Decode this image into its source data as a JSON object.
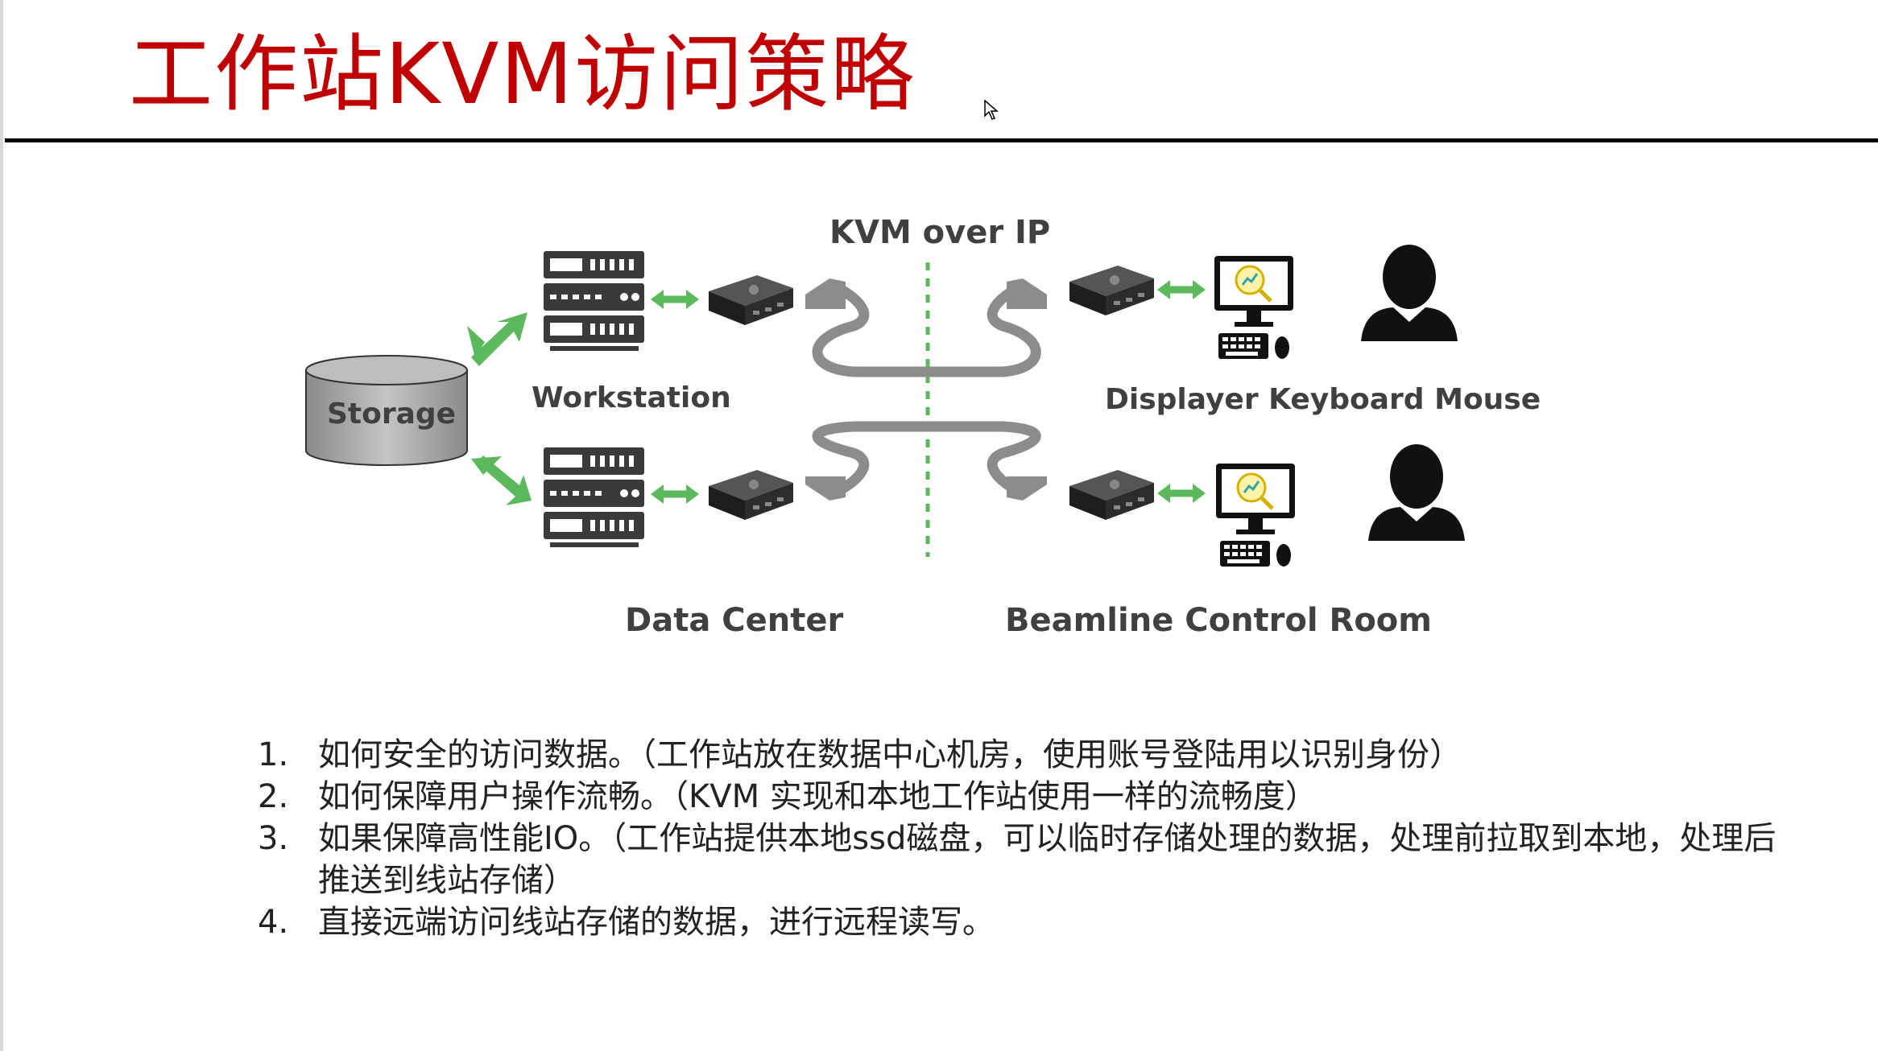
{
  "slide": {
    "title": "工作站KVM访问策略"
  },
  "diagram": {
    "kvm_label": "KVM over IP",
    "storage_label": "Storage",
    "workstation_label": "Workstation",
    "displayer_label": "Displayer Keyboard Mouse",
    "datacenter_label": "Data Center",
    "beamline_label": "Beamline Control Room"
  },
  "notes": [
    {
      "num": "1.",
      "text": "如何安全的访问数据。（工作站放在数据中心机房，使用账号登陆用以识别身份）"
    },
    {
      "num": "2.",
      "text": "如何保障用户操作流畅。（KVM 实现和本地工作站使用一样的流畅度）"
    },
    {
      "num": "3.",
      "text": "如果保障高性能IO。（工作站提供本地ssd磁盘，可以临时存储处理的数据，处理前拉取到本地，处理后推送到线站存储）"
    },
    {
      "num": "4.",
      "text": "直接远端访问线站存储的数据，进行远程读写。"
    }
  ],
  "colors": {
    "title": "#c00000",
    "arrow": "#5cb85c",
    "divider": "#5cb85c",
    "text": "#404040"
  }
}
